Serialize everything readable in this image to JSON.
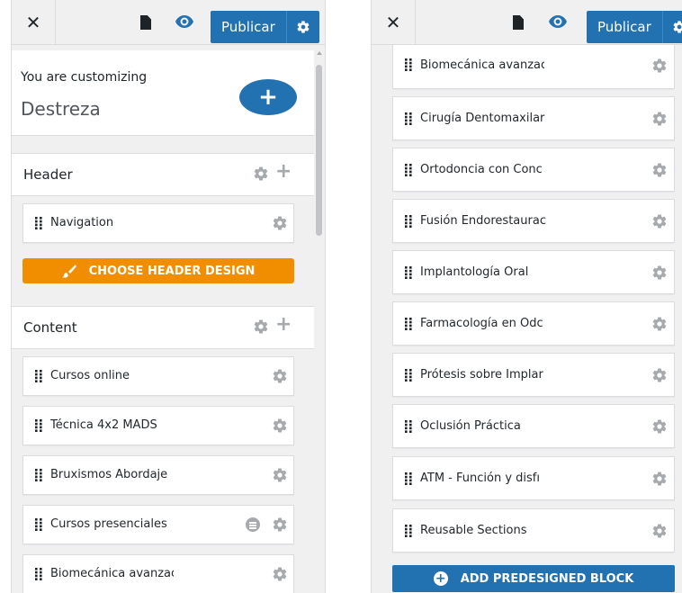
{
  "left_panel": {
    "close_icon": "close-icon",
    "publish_label": "Publicar",
    "customizing_label": "You are customizing",
    "site_title": "Destreza",
    "add_icon": "+",
    "header_section": {
      "title": "Header",
      "items": [
        {
          "label": "Navigation"
        }
      ],
      "choose_design_label": "CHOOSE HEADER DESIGN"
    },
    "content_section": {
      "title": "Content",
      "items": [
        {
          "label": "Cursos online"
        },
        {
          "label": "Técnica 4x2 MADS"
        },
        {
          "label": "Bruxismos Abordaje I"
        },
        {
          "label": "Cursos presenciales"
        },
        {
          "label": "Biomecánica avanzac"
        }
      ]
    }
  },
  "right_panel": {
    "publish_label": "Publicar",
    "items": [
      {
        "label": "Biomecánica avanzac"
      },
      {
        "label": "Cirugía Dentomaxilar"
      },
      {
        "label": "Ortodoncia con Conc"
      },
      {
        "label": "Fusión Endorestaurac"
      },
      {
        "label": "Implantología Oral"
      },
      {
        "label": "Farmacología en Odc"
      },
      {
        "label": "Prótesis sobre Implar"
      },
      {
        "label": "Oclusión Práctica"
      },
      {
        "label": "ATM - Función y disfı"
      },
      {
        "label": "Reusable Sections"
      }
    ],
    "add_block_label": "ADD PREDESIGNED BLOCK"
  },
  "colors": {
    "accent_blue": "#2271b1",
    "orange": "#f18e00",
    "icon_grey": "#a7aaad",
    "panel_bg": "#f0f0f1"
  }
}
